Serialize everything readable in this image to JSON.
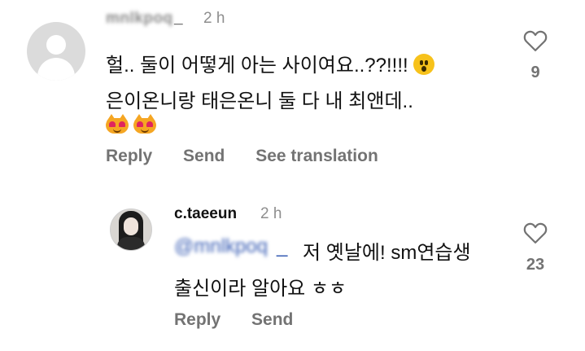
{
  "comment": {
    "username_visible": "_",
    "username_hidden": "mnlkpoq",
    "time": "2 h",
    "lines": [
      "헐.. 둘이 어떻게 아는 사이여요..??!!!!",
      "은이온니랑 태은온니 둘 다 내 최앤데.."
    ],
    "emoji": "😮",
    "cat_emojis": "😻😻",
    "actions": [
      "Reply",
      "Send",
      "See translation"
    ],
    "likes": "9"
  },
  "reply": {
    "username": "c.taeeun",
    "time": "2 h",
    "mention_hidden": "@mnlkpoq",
    "mention_visible": "_",
    "line1": "저 옛날에! sm연습생",
    "line2": "출신이라 알아요 ㅎㅎ",
    "actions": [
      "Reply",
      "Send"
    ],
    "likes": "23"
  }
}
